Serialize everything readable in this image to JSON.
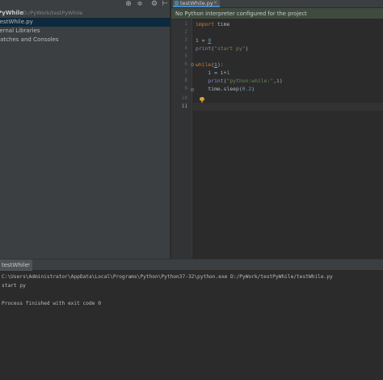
{
  "project": {
    "root_name": "PyWhile",
    "root_path": "D:/PyWork/testPyWhile",
    "file": "testWhile.py",
    "external_libs": "External Libraries",
    "scratches": "Scratches and Consoles"
  },
  "toolbar_icons": [
    "target-icon",
    "collapse-icon",
    "gear-icon",
    "hide-icon"
  ],
  "editor": {
    "tab_label": "testWhile.py",
    "tab_close": "×",
    "banner": "No Python interpreter configured for the project",
    "line_numbers": [
      "1",
      "2",
      "3",
      "4",
      "5",
      "6",
      "7",
      "8",
      "9",
      "10",
      "11"
    ],
    "current_line": "11",
    "code": {
      "l1_kw": "import",
      "l1_rest": " time",
      "l3_a": "i = ",
      "l3_b": "0",
      "l4_fn": "print",
      "l4_open": "(",
      "l4_str": "\"start py\"",
      "l4_close": ")",
      "l6_kw": "while",
      "l6_open": "(",
      "l6_var": "i",
      "l6_close": "):",
      "l7_a": "    i = i+",
      "l7_b": "1",
      "l8_indent": "    ",
      "l8_fn": "print",
      "l8_open": "(",
      "l8_str": "\"python:while:\"",
      "l8_rest": ",i)",
      "l9_a": "    time.sleep(",
      "l9_b": "0.2",
      "l9_c": ")"
    }
  },
  "run": {
    "tab_label": "testWhile",
    "tab_close": "×",
    "output": [
      "C:\\Users\\Administrator\\AppData\\Local\\Programs\\Python\\Python37-32\\python.exe D:/PyWork/testPyWhile/testWhile.py",
      "start py",
      "",
      "Process finished with exit code 0"
    ]
  },
  "colors": {
    "panel_bg": "#3c3f41",
    "editor_bg": "#2b2b2b",
    "keyword": "#cc7832",
    "string": "#6a8759",
    "number": "#6897bb",
    "builtin": "#8888c6",
    "selection": "#0d293e"
  }
}
